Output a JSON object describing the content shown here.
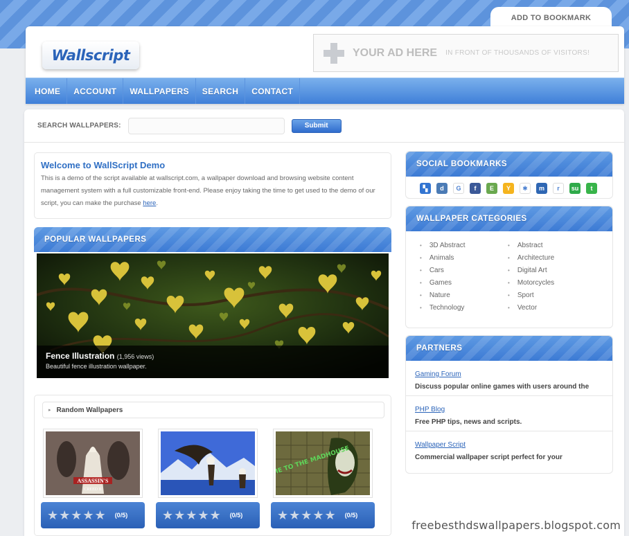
{
  "header": {
    "bookmark_label": "ADD TO BOOKMARK",
    "logo_text": "Wallscript",
    "ad_title": "YOUR AD HERE",
    "ad_subtitle": "IN FRONT OF THOUSANDS OF VISITORS!"
  },
  "nav": {
    "items": [
      {
        "label": "HOME"
      },
      {
        "label": "ACCOUNT"
      },
      {
        "label": "WALLPAPERS"
      },
      {
        "label": "SEARCH"
      },
      {
        "label": "CONTACT"
      }
    ]
  },
  "search": {
    "label": "SEARCH WALLPAPERS:",
    "value": "",
    "button_label": "Submit"
  },
  "welcome": {
    "title": "Welcome to WallScript Demo",
    "body": "This is a demo of the script available at wallscript.com, a wallpaper download and browsing website content management system with a full customizable front-end. Please enjoy taking the time to get used to the demo of our script, you can make the purchase ",
    "link_text": "here",
    "tail": "."
  },
  "popular": {
    "heading": "POPULAR WALLPAPERS",
    "feature_title": "Fence Illustration",
    "feature_views": "(1,956 views)",
    "feature_desc": "Beautiful fence illustration wallpaper."
  },
  "random": {
    "heading": "Random Wallpapers",
    "items": [
      {
        "stars": "★★★★★",
        "rating": "(0/5)",
        "logo_line1": "ASSASSIN'S",
        "logo_line2": "CREED II"
      },
      {
        "stars": "★★★★★",
        "rating": "(0/5)"
      },
      {
        "stars": "★★★★★",
        "rating": "(0/5)",
        "graffiti": "WELCOME TO THE MADHOUSE"
      }
    ]
  },
  "social": {
    "heading": "SOCIAL BOOKMARKS",
    "icons": [
      {
        "name": "delicious-icon",
        "glyph": "▚",
        "color": "#3274d1"
      },
      {
        "name": "digg-icon",
        "glyph": "d",
        "color": "#4b7bb5"
      },
      {
        "name": "google-icon",
        "glyph": "G",
        "color": "#ffffff"
      },
      {
        "name": "facebook-icon",
        "glyph": "f",
        "color": "#3b5998"
      },
      {
        "name": "evernote-icon",
        "glyph": "E",
        "color": "#6aa84f"
      },
      {
        "name": "yahoo-buzz-icon",
        "glyph": "Y",
        "color": "#f5b41e"
      },
      {
        "name": "windows-live-icon",
        "glyph": "✱",
        "color": "#ffffff"
      },
      {
        "name": "myspace-icon",
        "glyph": "m",
        "color": "#2f67b3"
      },
      {
        "name": "reddit-icon",
        "glyph": "r",
        "color": "#ffffff"
      },
      {
        "name": "stumbleupon-icon",
        "glyph": "su",
        "color": "#2faa4a"
      },
      {
        "name": "technorati-icon",
        "glyph": "t",
        "color": "#38b44a"
      }
    ]
  },
  "categories": {
    "heading": "WALLPAPER CATEGORIES",
    "col1": [
      "3D Abstract",
      "Animals",
      "Cars",
      "Games",
      "Nature",
      "Technology"
    ],
    "col2": [
      "Abstract",
      "Architecture",
      "Digital Art",
      "Motorcycles",
      "Sport",
      "Vector"
    ]
  },
  "partners": {
    "heading": "PARTNERS",
    "items": [
      {
        "name": "Gaming Forum",
        "desc": "Discuss popular online games with users around the"
      },
      {
        "name": "PHP Blog",
        "desc": "Free PHP tips, news and scripts."
      },
      {
        "name": "Wallpaper Script",
        "desc": "Commercial wallpaper script perfect for your"
      }
    ]
  },
  "watermark": "freebesthdswallpapers.blogspot.com"
}
